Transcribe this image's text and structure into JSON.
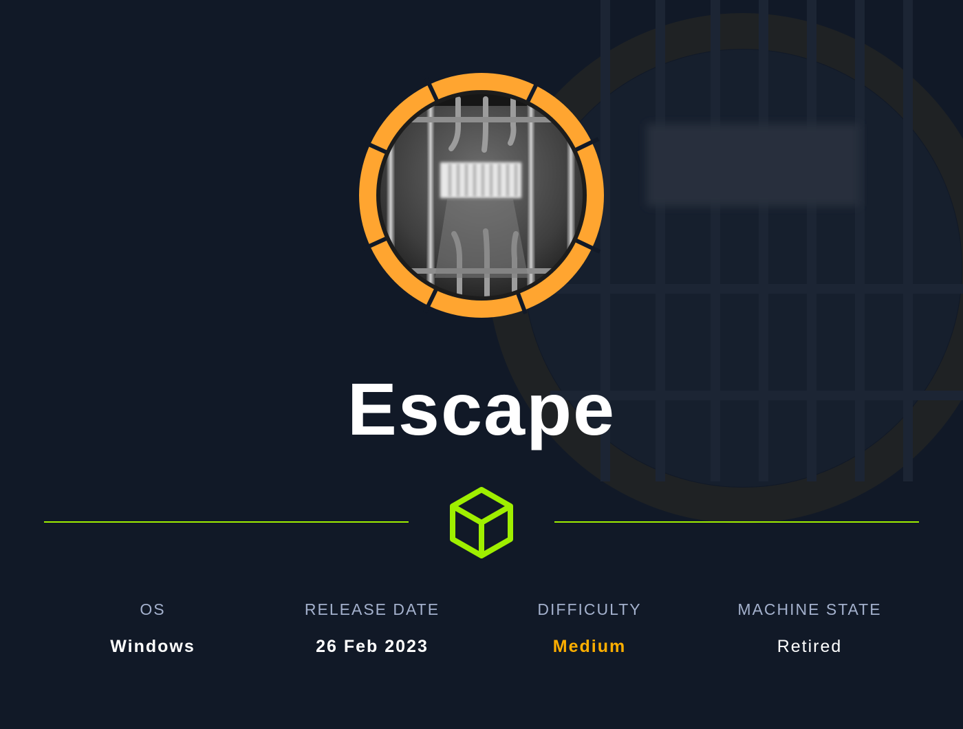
{
  "machine": {
    "title": "Escape",
    "logo_icon": "jail-cell-bars-icon",
    "badge_icon": "hackthebox-cube-icon"
  },
  "stats": {
    "os": {
      "label": "OS",
      "value": "Windows"
    },
    "release": {
      "label": "RELEASE DATE",
      "value": "26 Feb 2023"
    },
    "difficulty": {
      "label": "DIFFICULTY",
      "value": "Medium",
      "color": "#ffaf00"
    },
    "state": {
      "label": "MACHINE STATE",
      "value": "Retired"
    }
  },
  "colors": {
    "background": "#111927",
    "accent": "#9fef00",
    "ring": "#ffa530",
    "label": "#a4b1cd",
    "value": "#ffffff"
  }
}
